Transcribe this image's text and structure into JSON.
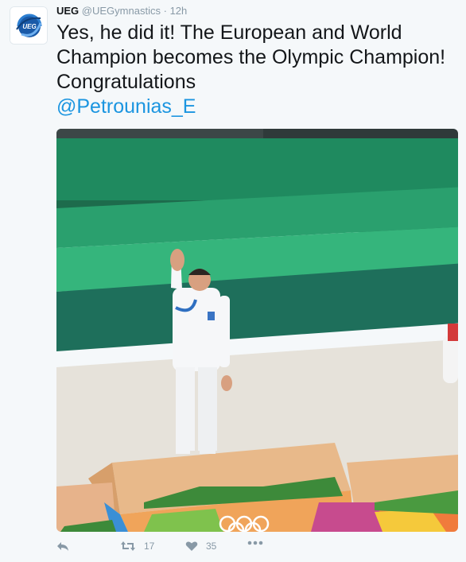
{
  "tweet": {
    "display_name": "UEG",
    "handle": "@UEGymnastics",
    "separator": "·",
    "time": "12h",
    "text_plain": "Yes, he did it! The European and World Champion becomes the Olympic Champion! Congratulations",
    "mention": "@Petrounias_E",
    "avatar_logo_text": "UEG"
  },
  "actions": {
    "reply_icon": "reply-icon",
    "retweet_icon": "retweet-icon",
    "retweet_count": "17",
    "like_icon": "heart-icon",
    "like_count": "35",
    "more_icon": "more-icon"
  },
  "colors": {
    "link": "#1b95e0",
    "text": "#14171a",
    "muted": "#8899a6",
    "background": "#f5f8fa"
  }
}
